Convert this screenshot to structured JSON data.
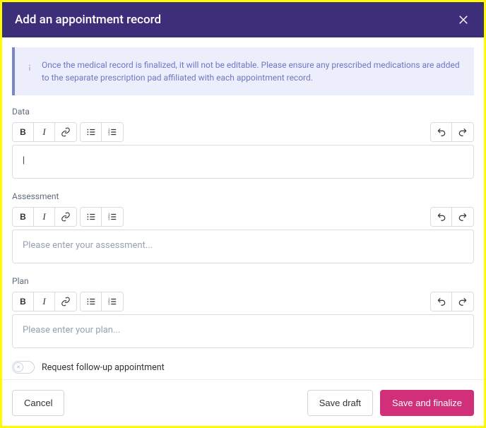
{
  "header": {
    "title": "Add an appointment record"
  },
  "info_banner": "Once the medical record is finalized, it will not be editable. Please ensure any prescribed medications are added to the separate prescription pad affiliated with each appointment record.",
  "sections": {
    "data": {
      "label": "Data",
      "content": "|",
      "placeholder": ""
    },
    "assessment": {
      "label": "Assessment",
      "placeholder": "Please enter your assessment..."
    },
    "plan": {
      "label": "Plan",
      "placeholder": "Please enter your plan..."
    }
  },
  "toggle": {
    "label": "Request follow-up appointment"
  },
  "footer": {
    "cancel": "Cancel",
    "save_draft": "Save draft",
    "save_finalize": "Save and finalize"
  }
}
